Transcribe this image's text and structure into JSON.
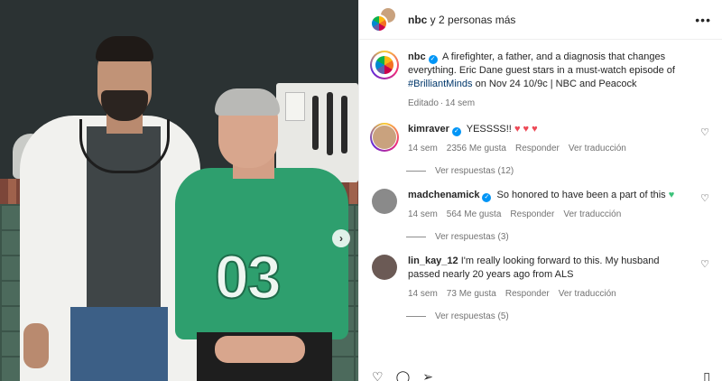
{
  "photo": {
    "jersey_number": "03",
    "next_icon": "chevron-right-icon"
  },
  "header": {
    "title_user": "nbc",
    "title_rest": " y 2 personas más",
    "more_icon": "more-horizontal-icon",
    "more_glyph": "•••"
  },
  "caption": {
    "user": "nbc",
    "text_before": "A firefighter, a father, and a diagnosis that changes everything. Eric Dane guest stars in a must-watch episode of ",
    "hashtag": "#BrilliantMinds",
    "text_after": " on Nov 24 10/9c | NBC and Peacock",
    "edited": "Editado",
    "dot": "·",
    "time": "14 sem"
  },
  "comments": [
    {
      "user": "kimraver",
      "verified": true,
      "text": "YESSSS!!",
      "emoji": "♥ ♥ ♥",
      "time": "14 sem",
      "likes": "2356 Me gusta",
      "reply": "Responder",
      "translate": "Ver traducción",
      "replies": "Ver respuestas (12)",
      "avatar_color": "#c9a27e"
    },
    {
      "user": "madchenamick",
      "verified": true,
      "text": "So honored to have been a part of this",
      "emoji": "♥",
      "time": "14 sem",
      "likes": "564 Me gusta",
      "reply": "Responder",
      "translate": "Ver traducción",
      "replies": "Ver respuestas (3)",
      "avatar_color": "#8a8a8a"
    },
    {
      "user": "lin_kay_12",
      "verified": false,
      "text": "I'm really looking forward to this. My husband passed nearly 20 years ago from ALS",
      "time": "14 sem",
      "likes": "73 Me gusta",
      "reply": "Responder",
      "translate": "Ver traducción",
      "replies": "Ver respuestas (5)",
      "avatar_color": "#6b5a55"
    }
  ],
  "icons": {
    "heart": "♡",
    "like_action": "heart-icon",
    "comment_action": "comment-icon",
    "share_action": "share-icon",
    "save_action": "bookmark-icon"
  }
}
